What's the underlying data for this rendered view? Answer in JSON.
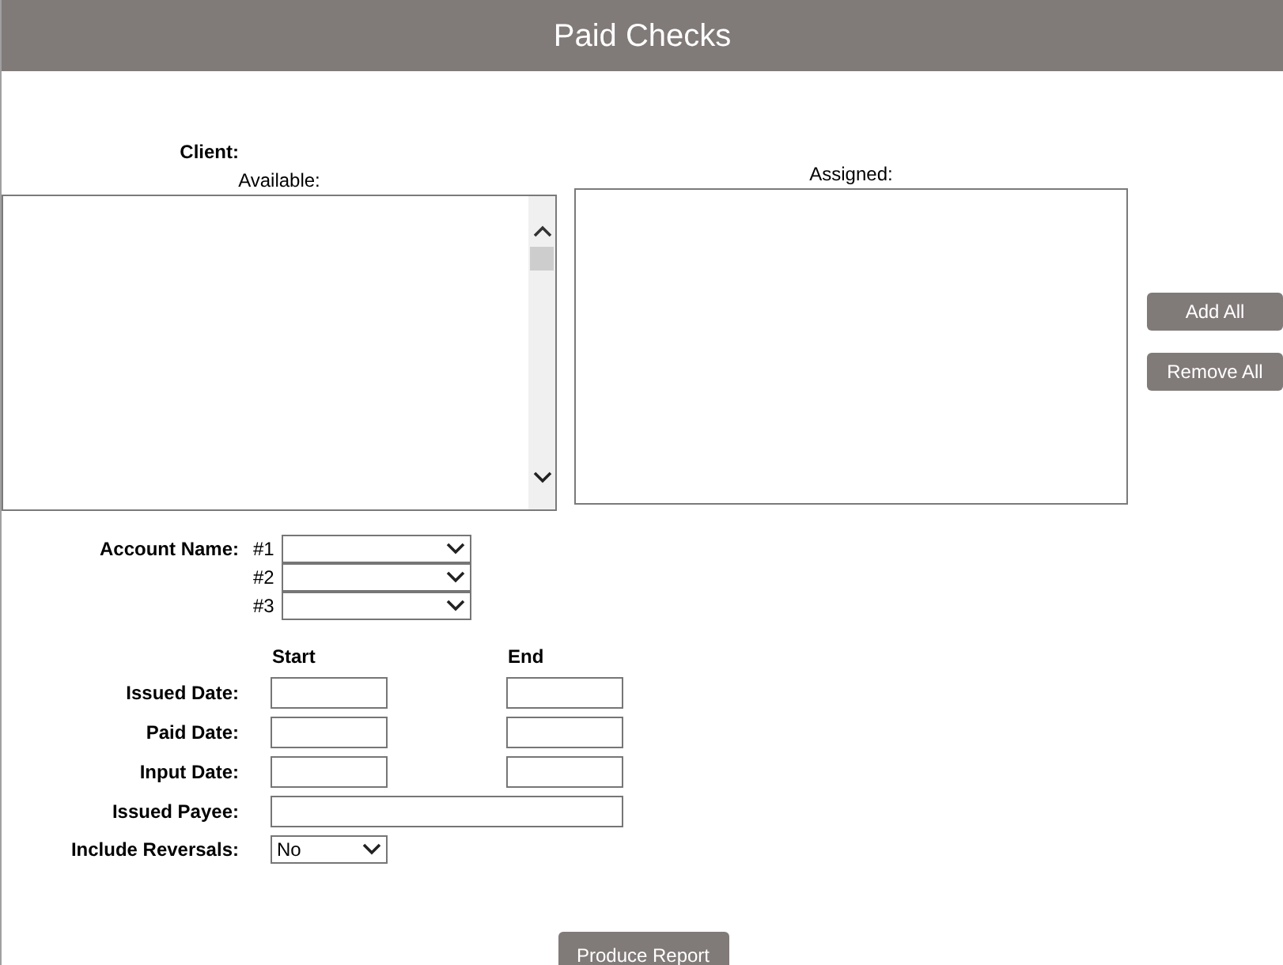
{
  "header": {
    "title": "Paid Checks"
  },
  "client": {
    "label": "Client:",
    "available_label": "Available:",
    "assigned_label": "Assigned:"
  },
  "list_buttons": [
    {
      "label": "Add All"
    },
    {
      "label": "Remove All"
    }
  ],
  "account_name": {
    "label": "Account Name:",
    "selects": [
      {
        "prefix": "#1"
      },
      {
        "prefix": "#2"
      },
      {
        "prefix": "#3"
      }
    ]
  },
  "date_headers": {
    "start": "Start",
    "end": "End"
  },
  "date_rows": [
    {
      "label": "Issued Date:"
    },
    {
      "label": "Paid Date:"
    },
    {
      "label": "Input Date:"
    }
  ],
  "issued_payee": {
    "label": "Issued Payee:"
  },
  "include_reversals": {
    "label": "Include Reversals:",
    "value": "No"
  },
  "produce_button": {
    "label": "Produce Report"
  }
}
